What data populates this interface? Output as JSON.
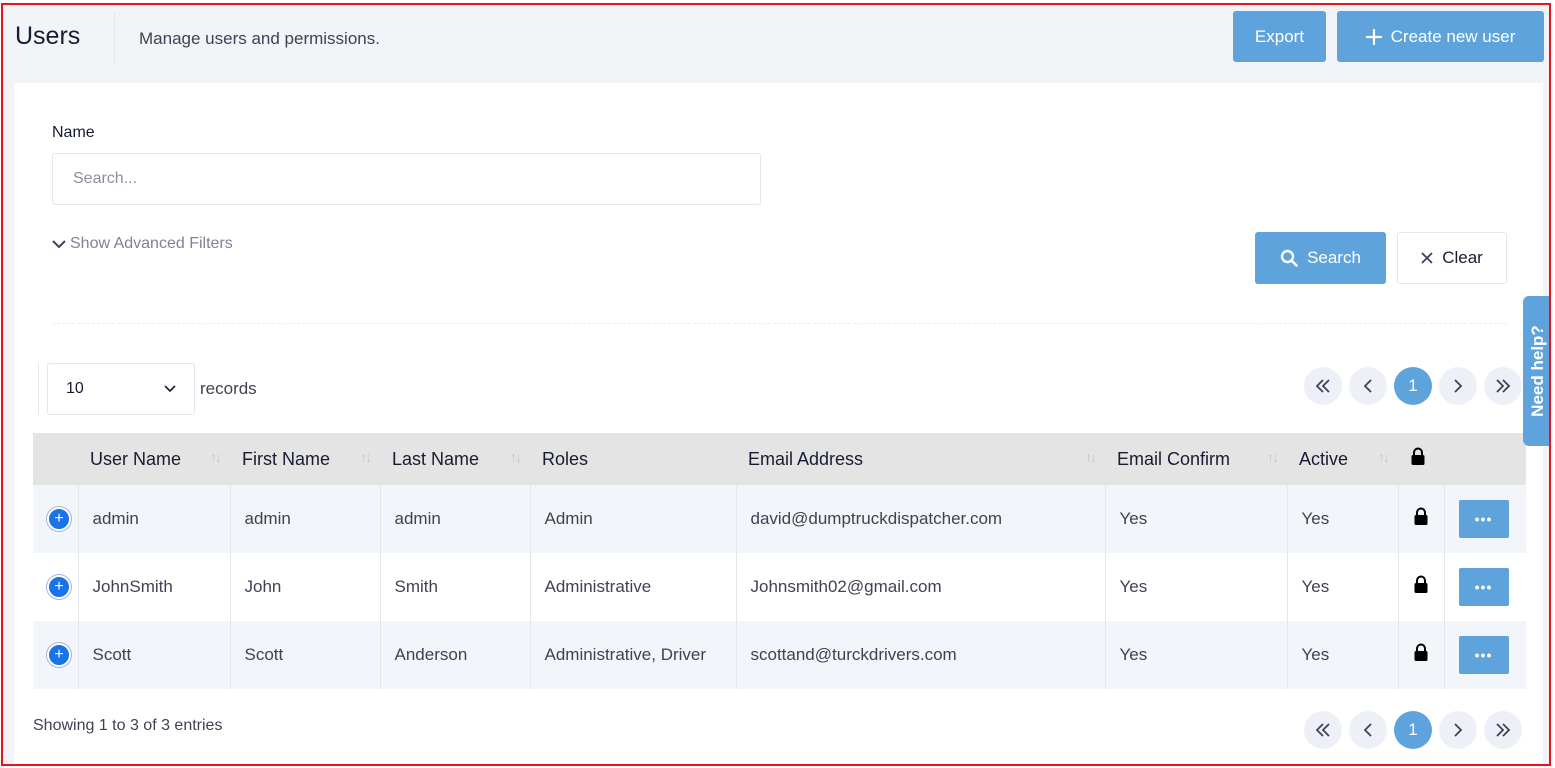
{
  "header": {
    "title": "Users",
    "subtitle": "Manage users and permissions.",
    "export_label": "Export",
    "create_label": "Create new user"
  },
  "filters": {
    "name_label": "Name",
    "search_placeholder": "Search...",
    "advanced_label": "Show Advanced Filters",
    "search_button": "Search",
    "clear_button": "Clear"
  },
  "length": {
    "value": "10",
    "label": "records"
  },
  "pager": {
    "current_page": "1"
  },
  "help_tab": "Need help?",
  "table": {
    "columns": [
      "User Name",
      "First Name",
      "Last Name",
      "Roles",
      "Email Address",
      "Email Confirm",
      "Active"
    ],
    "rows": [
      {
        "username": "admin",
        "first": "admin",
        "last": "admin",
        "roles": "Admin",
        "email": "david@dumptruckdispatcher.com",
        "confirm": "Yes",
        "active": "Yes"
      },
      {
        "username": "JohnSmith",
        "first": "John",
        "last": "Smith",
        "roles": "Administrative",
        "email": "Johnsmith02@gmail.com",
        "confirm": "Yes",
        "active": "Yes"
      },
      {
        "username": "Scott",
        "first": "Scott",
        "last": "Anderson",
        "roles": "Administrative, Driver",
        "email": "scottand@turckdrivers.com",
        "confirm": "Yes",
        "active": "Yes"
      }
    ]
  },
  "footer": {
    "info": "Showing 1 to 3 of 3 entries"
  },
  "colors": {
    "primary": "#5ea3db",
    "frame_border": "#e4161b",
    "expand": "#1a73e8"
  }
}
